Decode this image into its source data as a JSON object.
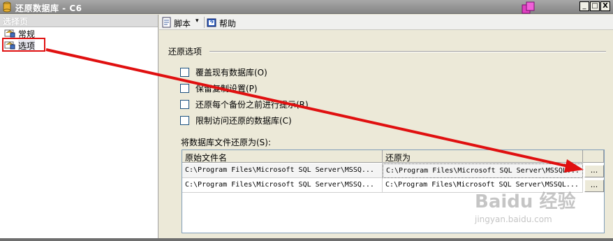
{
  "window": {
    "title": "还原数据库 - C6",
    "minimize_label": "_",
    "restore_label": "□",
    "close_label": "X"
  },
  "left_panel": {
    "header": "选择页",
    "pages": [
      {
        "label": "常规",
        "selected": false
      },
      {
        "label": "选项",
        "selected": true
      }
    ]
  },
  "toolbar": {
    "script_label": "脚本",
    "dropdown_glyph": "▾",
    "help_label": "帮助"
  },
  "restore_options": {
    "group_label": "还原选项",
    "checkboxes": [
      {
        "label": "覆盖现有数据库(O)",
        "checked": false
      },
      {
        "label": "保留复制设置(P)",
        "checked": false
      },
      {
        "label": "还原每个备份之前进行提示(R)",
        "checked": false
      },
      {
        "label": "限制访问还原的数据库(C)",
        "checked": false
      }
    ]
  },
  "file_grid": {
    "label": "将数据库文件还原为(S):",
    "columns": [
      "原始文件名",
      "还原为"
    ],
    "rows": [
      {
        "original": "C:\\Program Files\\Microsoft SQL Server\\MSSQ...",
        "restore_as": "C:\\Program Files\\Microsoft SQL Server\\MSSQL...",
        "browse": "..."
      },
      {
        "original": "C:\\Program Files\\Microsoft SQL Server\\MSSQ...",
        "restore_as": "C:\\Program Files\\Microsoft SQL Server\\MSSQL...",
        "browse": "..."
      }
    ]
  },
  "watermark": {
    "brand": "Baidu 经验",
    "url": "jingyan.baidu.com"
  },
  "colors": {
    "annotation_red": "#e01010",
    "titlebar": "#999999"
  }
}
